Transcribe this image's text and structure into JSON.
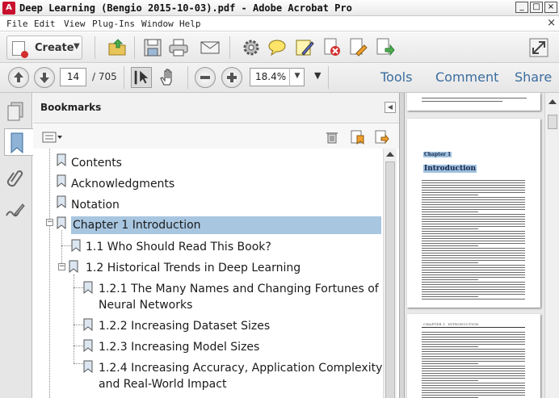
{
  "window": {
    "title": "Deep Learning (Bengio 2015-10-03).pdf - Adobe Acrobat Pro",
    "app_icon_glyph": "A",
    "controls": [
      "_",
      "□",
      "×"
    ]
  },
  "menu": {
    "items": [
      "File",
      "Edit",
      "View",
      "Plug-Ins",
      "Window",
      "Help"
    ],
    "close_glyph": "×"
  },
  "toolbar": {
    "create_label": "Create",
    "icons": [
      "open-folder",
      "save",
      "print",
      "email",
      "settings-gear",
      "comment-bubble",
      "sign-pen",
      "delete-page",
      "edit-page",
      "export-page"
    ]
  },
  "nav": {
    "current_page": "14",
    "total_pages": "/ 705",
    "zoom": "18.4%",
    "pane_links": [
      "Tools",
      "Comment",
      "Share"
    ]
  },
  "bookmarks": {
    "title": "Bookmarks",
    "items": [
      {
        "label": "Contents"
      },
      {
        "label": "Acknowledgments"
      },
      {
        "label": "Notation"
      },
      {
        "label": "Chapter 1 Introduction",
        "selected": true
      },
      {
        "label": "1.1 Who Should Read This Book?"
      },
      {
        "label": "1.2 Historical Trends in Deep Learning"
      },
      {
        "label": "1.2.1 The Many Names and Changing Fortunes of",
        "label2": "Neural Networks"
      },
      {
        "label": "1.2.2 Increasing Dataset Sizes"
      },
      {
        "label": "1.2.3 Increasing Model Sizes"
      },
      {
        "label": "1.2.4 Increasing Accuracy, Application Complexity",
        "label2": "and Real-World Impact"
      }
    ]
  },
  "document": {
    "chapter_label": "Chapter 1",
    "heading": "Introduction",
    "running_header": "CHAPTER 1.  INTRODUCTION"
  },
  "colors": {
    "selection": "#a8c6e0",
    "link_blue": "#3a6c9e",
    "toolbar_bg": "#ececec"
  }
}
